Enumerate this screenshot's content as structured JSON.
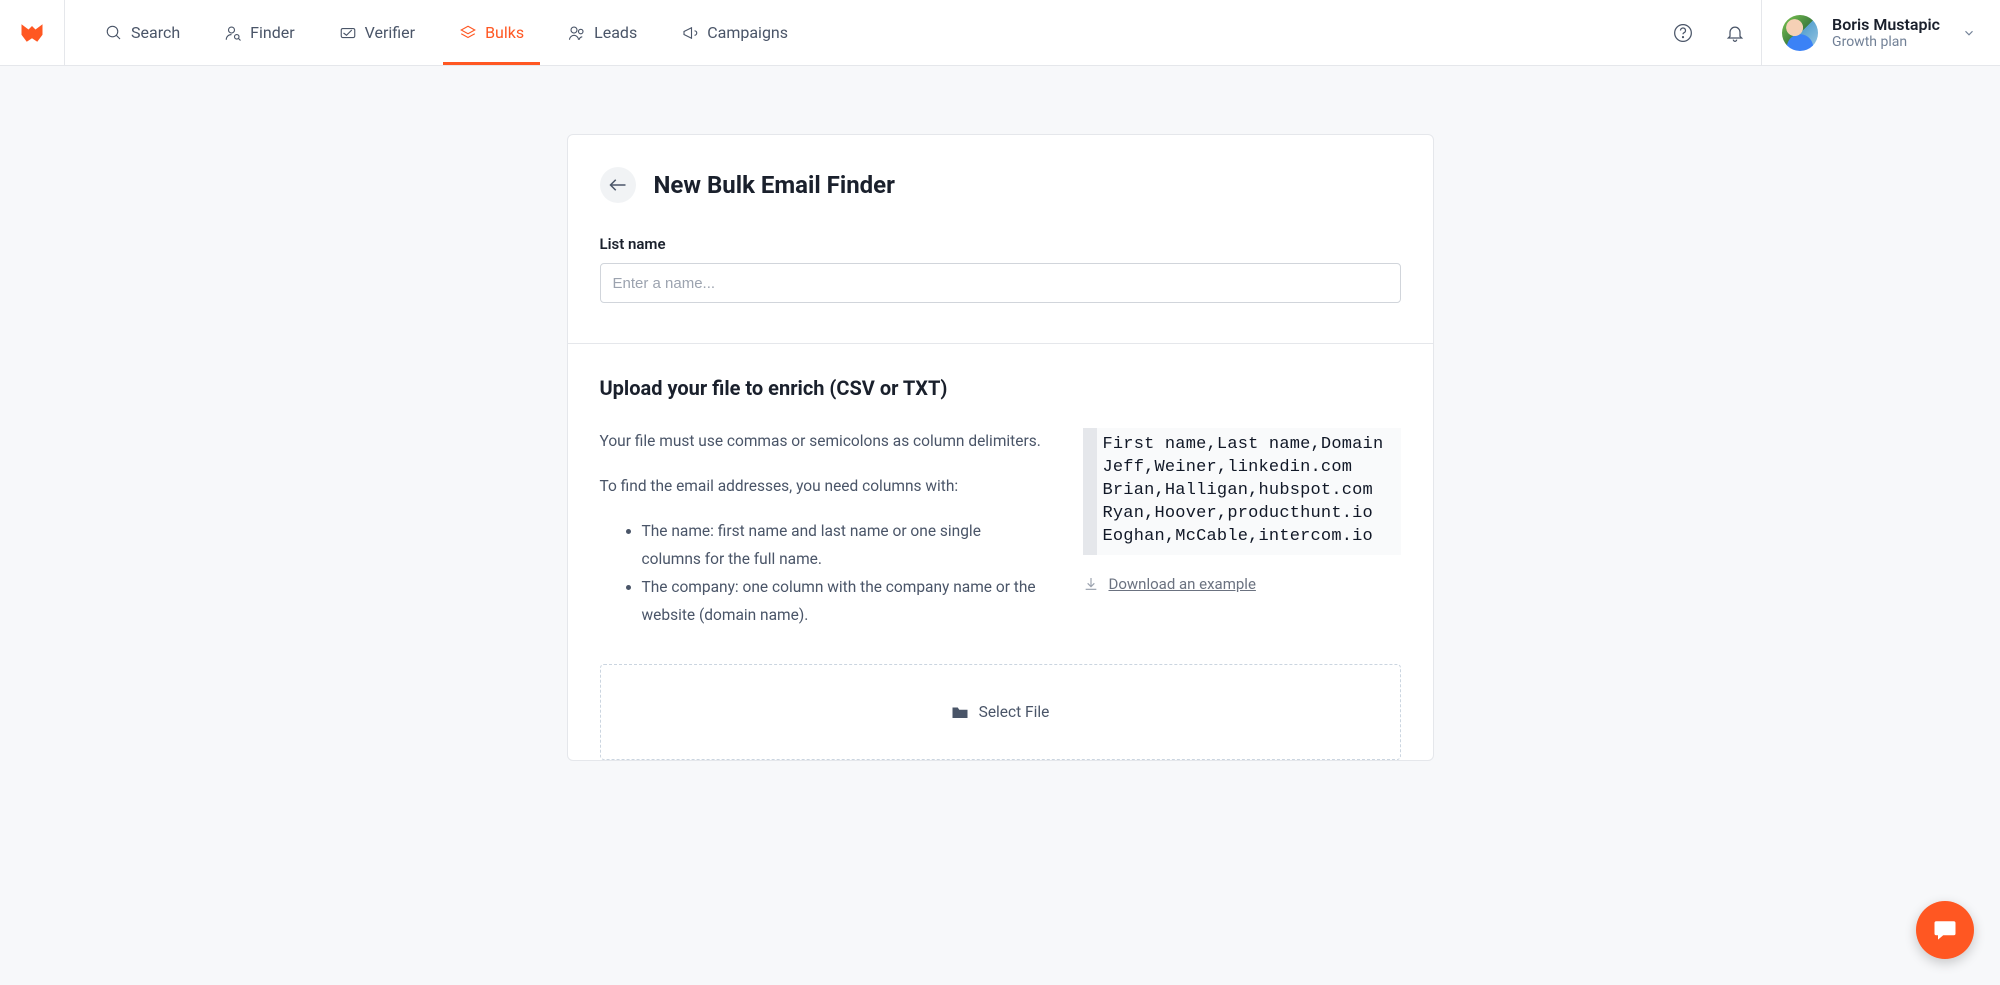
{
  "nav": {
    "items": [
      {
        "label": "Search"
      },
      {
        "label": "Finder"
      },
      {
        "label": "Verifier"
      },
      {
        "label": "Bulks"
      },
      {
        "label": "Leads"
      },
      {
        "label": "Campaigns"
      }
    ]
  },
  "user": {
    "name": "Boris Mustapic",
    "plan": "Growth plan"
  },
  "page": {
    "title": "New Bulk Email Finder",
    "list_name_label": "List name",
    "list_name_placeholder": "Enter a name...",
    "upload_heading": "Upload your file to enrich (CSV or TXT)",
    "instruction_delimiters": "Your file must use commas or semicolons as column delimiters.",
    "instruction_columns_intro": "To find the email addresses, you need columns with:",
    "bullet_name": "The name: first name and last name or one single columns for the full name.",
    "bullet_company": "The company: one column with the company name or the website (domain name).",
    "example_lines": [
      "First name,Last name,Domain",
      "Jeff,Weiner,linkedin.com",
      "Brian,Halligan,hubspot.com",
      "Ryan,Hoover,producthunt.io",
      "Eoghan,McCable,intercom.io"
    ],
    "download_example": "Download an example",
    "select_file": "Select File"
  }
}
